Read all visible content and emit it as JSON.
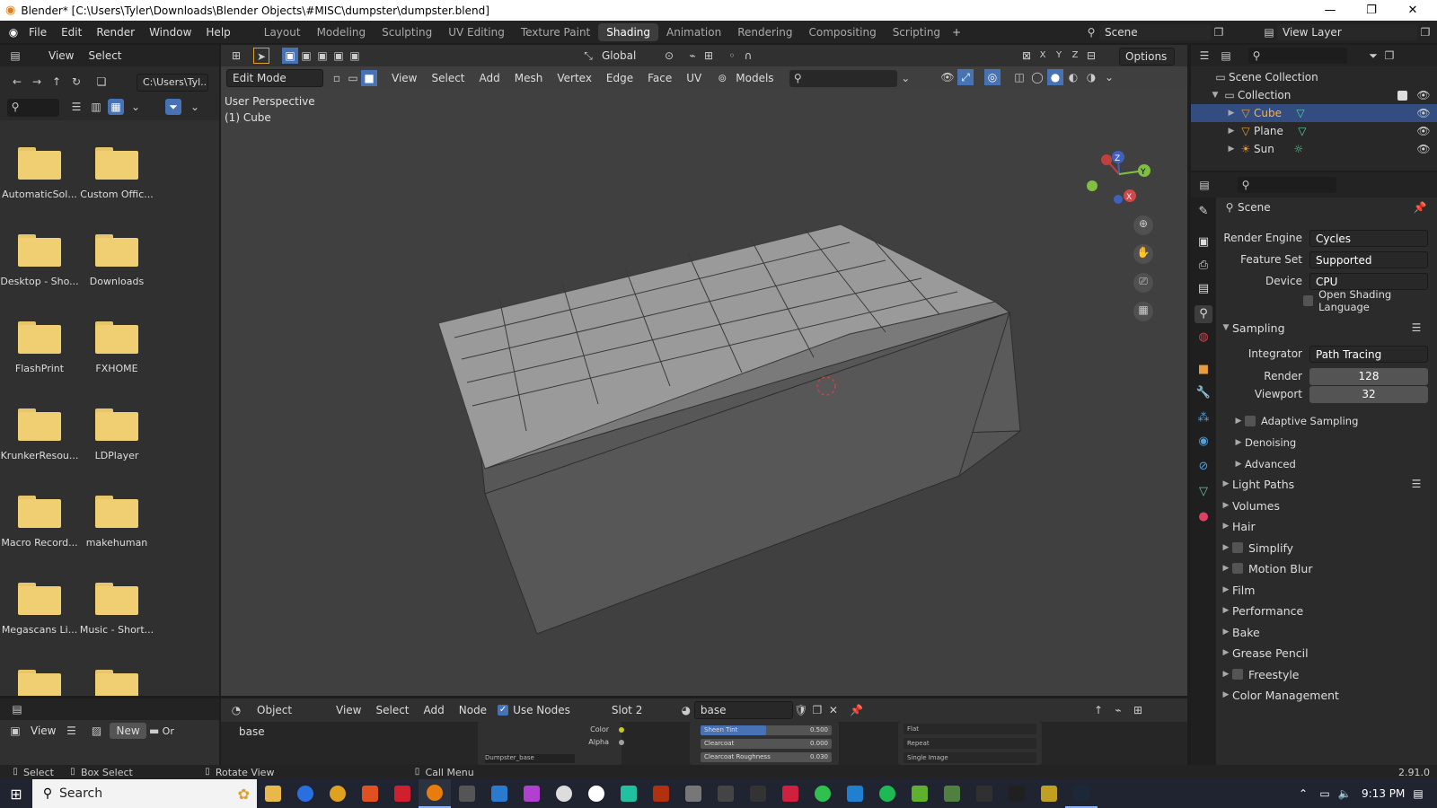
{
  "window": {
    "title": "Blender* [C:\\Users\\Tyler\\Downloads\\Blender Objects\\#MISC\\dumpster\\dumpster.blend]",
    "minimize": "—",
    "maximize": "❐",
    "close": "✕"
  },
  "menu": [
    "File",
    "Edit",
    "Render",
    "Window",
    "Help"
  ],
  "workspaces": [
    "Layout",
    "Modeling",
    "Sculpting",
    "UV Editing",
    "Texture Paint",
    "Shading",
    "Animation",
    "Rendering",
    "Compositing",
    "Scripting"
  ],
  "active_workspace": "Shading",
  "scene_name": "Scene",
  "view_layer": "View Layer",
  "file_browser": {
    "menu_view": "View",
    "menu_select": "Select",
    "path": "C:\\Users\\Tyl...",
    "folders": [
      "AutomaticSol...",
      "Custom Offic...",
      "Desktop - Sho...",
      "Downloads",
      "FlashPrint",
      "FXHOME",
      "KrunkerResou...",
      "LDPlayer",
      "Macro Record...",
      "makehuman",
      "Megascans Li...",
      "Music - Short..."
    ]
  },
  "viewport": {
    "transform_orientation": "Global",
    "options": "Options",
    "mode": "Edit Mode",
    "menus": [
      "View",
      "Select",
      "Add",
      "Mesh",
      "Vertex",
      "Edge",
      "Face",
      "UV"
    ],
    "uv_source": "Models",
    "overlay_title": "User Perspective",
    "overlay_object": "(1) Cube",
    "axis_x": "X",
    "axis_y": "Y",
    "axis_z": "Z",
    "header_axes": [
      "X",
      "Y",
      "Z"
    ]
  },
  "node_editor": {
    "object_dropdown": "Object",
    "menus": [
      "View",
      "Select",
      "Add",
      "Node"
    ],
    "use_nodes_label": "Use Nodes",
    "use_nodes": true,
    "slot": "Slot 2",
    "material": "base",
    "node_fields": [
      {
        "label": "Sheen Tint",
        "value": "0.500",
        "fill": 0.5
      },
      {
        "label": "Clearcoat",
        "value": "0.000",
        "fill": 0
      },
      {
        "label": "Clearcoat Roughness",
        "value": "0.030",
        "fill": 0.03
      }
    ],
    "node_sockets": [
      "Color",
      "Alpha"
    ],
    "node_name": "Dumpster_base",
    "image_options": [
      "Flat",
      "Repeat",
      "Single Image"
    ]
  },
  "mini_editor": {
    "view": "View",
    "new": "New",
    "material": "base",
    "trailing": "Or"
  },
  "outliner": {
    "root": "Scene Collection",
    "collection": "Collection",
    "items": [
      {
        "name": "Cube",
        "selected": true
      },
      {
        "name": "Plane",
        "selected": false
      },
      {
        "name": "Sun",
        "selected": false
      }
    ]
  },
  "properties": {
    "context": "Scene",
    "render_engine_label": "Render Engine",
    "render_engine": "Cycles",
    "feature_set_label": "Feature Set",
    "feature_set": "Supported",
    "device_label": "Device",
    "device": "CPU",
    "osl_label": "Open Shading Language",
    "sampling": "Sampling",
    "integrator_label": "Integrator",
    "integrator": "Path Tracing",
    "render_label": "Render",
    "render_samples": "128",
    "viewport_label": "Viewport",
    "viewport_samples": "32",
    "sub_panels": [
      "Adaptive Sampling",
      "Denoising",
      "Advanced"
    ],
    "panels": [
      "Light Paths",
      "Volumes",
      "Hair",
      "Simplify",
      "Motion Blur",
      "Film",
      "Performance",
      "Bake",
      "Grease Pencil",
      "Freestyle",
      "Color Management"
    ]
  },
  "status": {
    "select": "Select",
    "box_select": "Box Select",
    "rotate": "Rotate View",
    "call_menu": "Call Menu",
    "version": "2.91.0"
  },
  "taskbar": {
    "search": "Search",
    "time": "9:13 PM"
  },
  "colors": {
    "accent": "#4772b3",
    "folder": "#f0cf72",
    "selection": "#334d80"
  }
}
